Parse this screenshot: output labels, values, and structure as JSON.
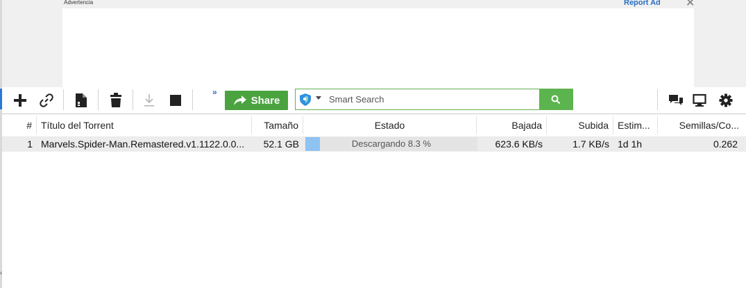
{
  "ad": {
    "warning_label": "Advertencia",
    "report_label": "Report Ad",
    "close_symbol": "✕"
  },
  "toolbar": {
    "icons": [
      "add-icon",
      "link-icon",
      "file-icon",
      "trash-icon",
      "download-icon",
      "stop-icon",
      "more-icon",
      "chat-icon",
      "monitor-icon",
      "gear-icon"
    ],
    "more_symbol": "»",
    "share_label": "Share",
    "share_color": "#4aa33f",
    "search": {
      "placeholder": "Smart Search",
      "value": ""
    }
  },
  "table": {
    "columns": [
      "#",
      "Título del Torrent",
      "Tamaño",
      "Estado",
      "Bajada",
      "Subida",
      "Estim...",
      "Semillas/Co..."
    ],
    "rows": [
      {
        "index": "1",
        "name": "Marvels.Spider-Man.Remastered.v1.1122.0.0...",
        "size": "52.1 GB",
        "status": "Descargando 8.3 %",
        "progress": 0.083,
        "down": "623.6 KB/s",
        "up": "1.7 KB/s",
        "eta": "1d 1h",
        "ratio": "0.262"
      }
    ]
  },
  "colors": {
    "accent_green": "#4aa33f",
    "progress_blue": "#8fc3f2",
    "link_blue": "#2a6ebf"
  }
}
